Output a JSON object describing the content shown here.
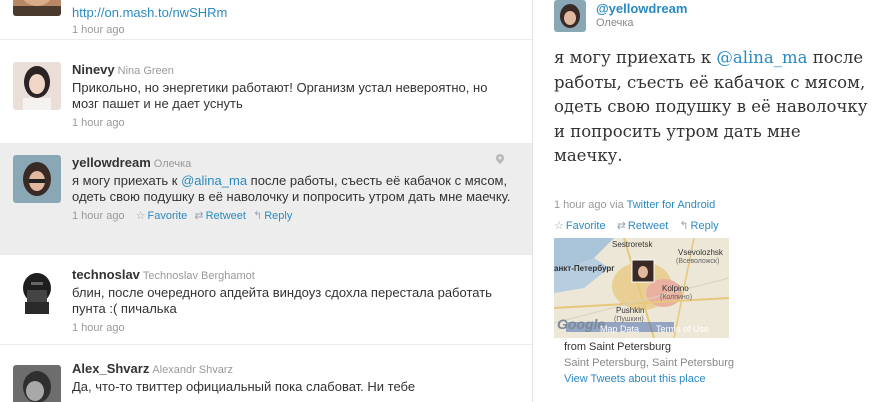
{
  "timeline": [
    {
      "screen_name": "",
      "full_name": "",
      "text": "",
      "link": "http://on.mash.to/nwSHRm",
      "time": "1 hour ago"
    },
    {
      "screen_name": "Ninevy",
      "full_name": "Nina Green",
      "text": "Прикольно, но энергетики работают! Организм устал невероятно, но мозг пашет и не дает уснуть",
      "time": "1 hour ago"
    },
    {
      "screen_name": "yellowdream",
      "full_name": "Олечка",
      "text_before": "я могу приехать к ",
      "mention": "@alina_ma",
      "text_after": " после работы, съесть её кабачок с мясом, одеть свою подушку в её наволочку и попросить утром дать мне маечку.",
      "time": "1 hour ago",
      "favorite": "Favorite",
      "retweet": "Retweet",
      "reply": "Reply"
    },
    {
      "screen_name": "technoslav",
      "full_name": "Technoslav Berghamot",
      "text": "блин, после очередного апдейта виндоуз сдохла перестала работать пунта :( пичалька",
      "time": "1 hour ago"
    },
    {
      "screen_name": "Alex_Shvarz",
      "full_name": "Alexandr Shvarz",
      "text": "Да, что-то твиттер официальный пока слабоват. Ни тебе"
    }
  ],
  "detail": {
    "screen_name": "@yellowdream",
    "full_name": "Олечка",
    "text_before": "я могу приехать к ",
    "mention": "@alina_ma",
    "text_after": " после работы, съесть её кабачок с мясом, одеть свою подушку в её наволочку и попросить утром дать мне маечку.",
    "time": "1 hour ago",
    "via_label": "via",
    "via": "Twitter for Android",
    "favorite": "Favorite",
    "retweet": "Retweet",
    "reply": "Reply",
    "map": {
      "labels": [
        "Sestroretsk",
        "Vsevolozhsk",
        "(Всеволожск)",
        "анкт-Петербург",
        "Kolpino",
        "(Колпино)",
        "Pushkin",
        "(Пушкин)"
      ],
      "google": "Google",
      "map_data": "Map Data",
      "terms": "Terms of Use"
    },
    "place_from": "from Saint Petersburg",
    "place_name": "Saint Petersburg, Saint Petersburg",
    "place_link": "View Tweets about this place"
  },
  "colors": {
    "link": "#2b8ac2",
    "selected_bg": "#ededed"
  }
}
